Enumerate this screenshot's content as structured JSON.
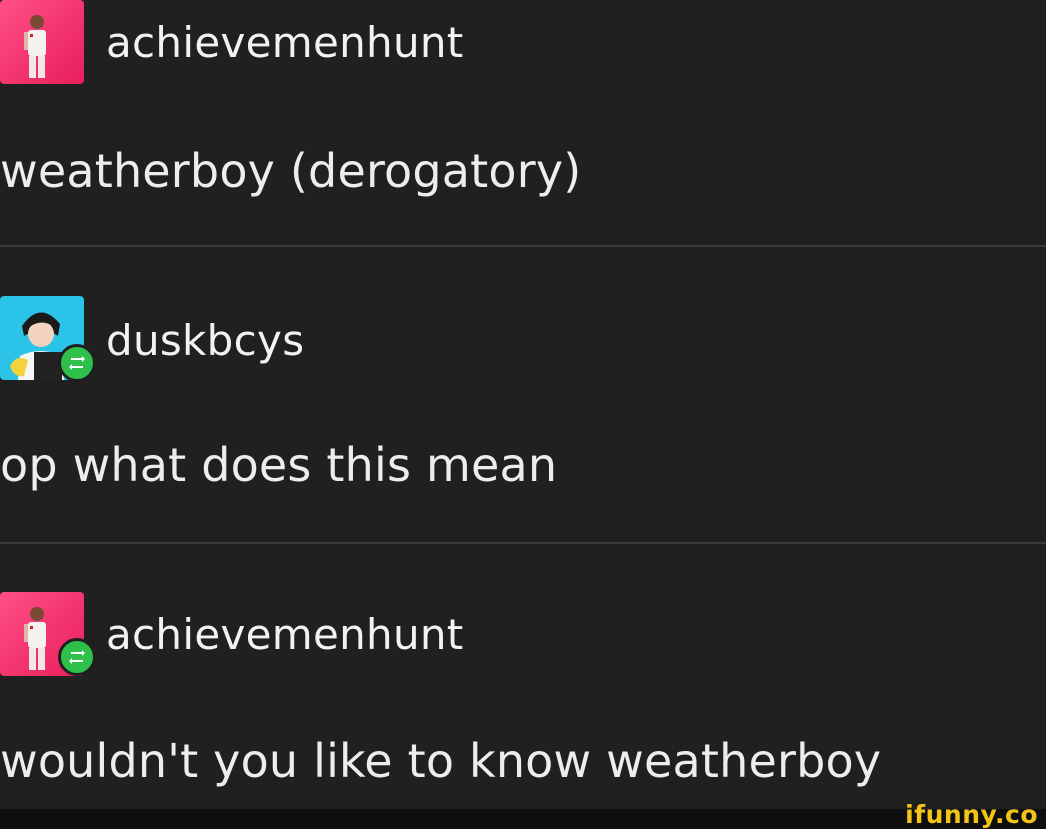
{
  "posts": [
    {
      "username": "achievemenhunt",
      "body": "weatherboy (derogatory)",
      "avatar_icon": "pink-avatar-icon",
      "reblog_badge": false
    },
    {
      "username": "duskbcys",
      "body": "op what does this mean",
      "avatar_icon": "cyan-avatar-icon",
      "reblog_badge": true
    },
    {
      "username": "achievemenhunt",
      "body": "wouldn't you like to know weatherboy",
      "avatar_icon": "pink-avatar-icon",
      "reblog_badge": true
    }
  ],
  "watermark": "ifunny.co",
  "colors": {
    "background": "#202021",
    "divider": "#3a3a3c",
    "reblog_green": "#2ec04a",
    "watermark_yellow": "#f3c316",
    "avatar_pink": "#f0306a",
    "avatar_cyan": "#2bc3e8"
  }
}
